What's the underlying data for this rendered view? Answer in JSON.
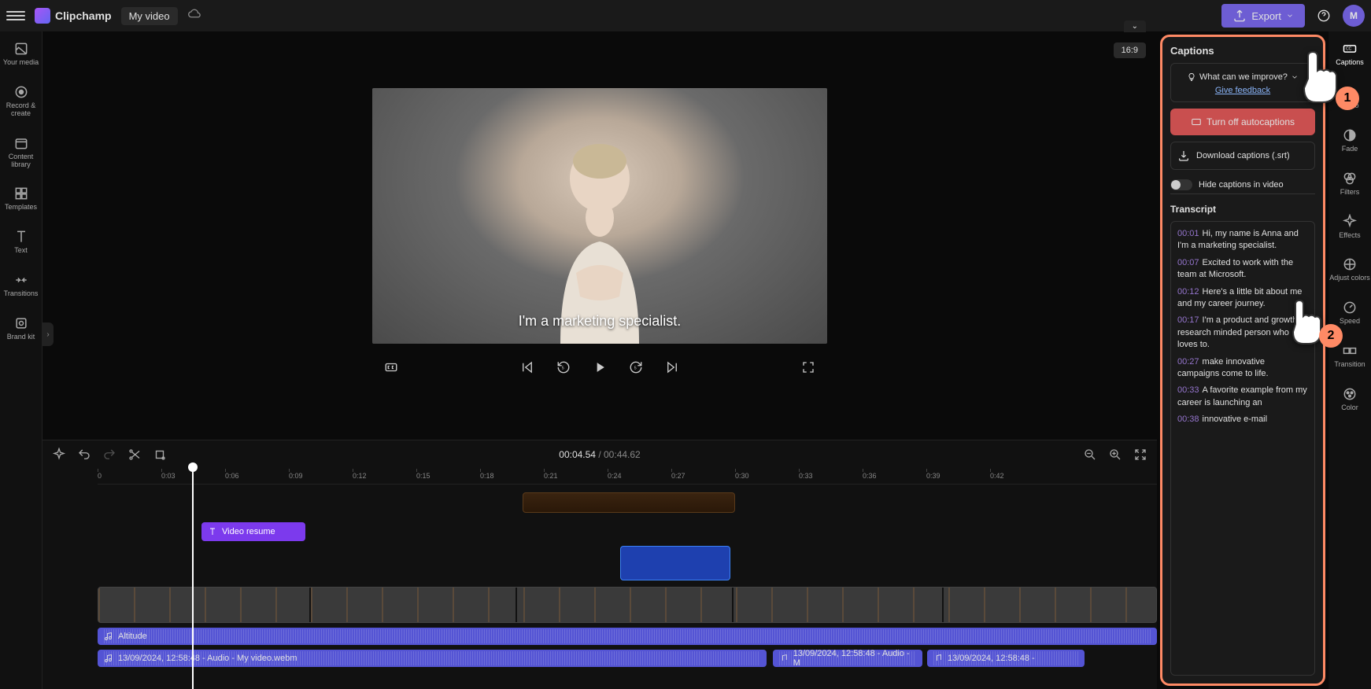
{
  "app": {
    "name": "Clipchamp",
    "project": "My video",
    "aspect": "16:9",
    "export_label": "Export",
    "avatar_initial": "M"
  },
  "left_rail": [
    {
      "label": "Your media",
      "icon": "media"
    },
    {
      "label": "Record & create",
      "icon": "record"
    },
    {
      "label": "Content library",
      "icon": "library"
    },
    {
      "label": "Templates",
      "icon": "templates"
    },
    {
      "label": "Text",
      "icon": "text"
    },
    {
      "label": "Transitions",
      "icon": "transitions"
    },
    {
      "label": "Brand kit",
      "icon": "brand"
    }
  ],
  "far_rail": [
    {
      "label": "Captions",
      "icon": "cc",
      "active": true
    },
    {
      "label": "Audio",
      "icon": "audio"
    },
    {
      "label": "Fade",
      "icon": "fade"
    },
    {
      "label": "Filters",
      "icon": "filters"
    },
    {
      "label": "Effects",
      "icon": "effects"
    },
    {
      "label": "Adjust colors",
      "icon": "adjust"
    },
    {
      "label": "Speed",
      "icon": "speed"
    },
    {
      "label": "Transition",
      "icon": "transition"
    },
    {
      "label": "Color",
      "icon": "color"
    }
  ],
  "preview": {
    "caption": "I'm a marketing specialist."
  },
  "timeline": {
    "current": "00:04.54",
    "duration": "00:44.62",
    "ticks": [
      "0",
      "0:03",
      "0:06",
      "0:09",
      "0:12",
      "0:15",
      "0:18",
      "0:21",
      "0:24",
      "0:27",
      "0:30",
      "0:33",
      "0:36",
      "0:39",
      "0:42"
    ],
    "text_clip": "Video resume",
    "audio1_label": "Altitude",
    "audio2_label": "13/09/2024, 12:58:48 - Audio - My video.webm",
    "audio3_label": "13/09/2024, 12:58:48 - Audio - M",
    "audio4_label": "13/09/2024, 12:58:48 -"
  },
  "captions_panel": {
    "title": "Captions",
    "feedback_q": "What can we improve?",
    "feedback_link": "Give feedback",
    "autocap_btn": "Turn off autocaptions",
    "download_btn": "Download captions (.srt)",
    "hide_toggle": "Hide captions in video",
    "transcript_title": "Transcript",
    "transcript": [
      {
        "t": "00:01",
        "text": "Hi, my name is Anna and I'm a marketing specialist."
      },
      {
        "t": "00:07",
        "text": "Excited to work with the team at Microsoft."
      },
      {
        "t": "00:12",
        "text": "Here's a little bit about me and my career journey."
      },
      {
        "t": "00:17",
        "text": "I'm a product and growth research minded person who loves to."
      },
      {
        "t": "00:27",
        "text": "make innovative campaigns come to life."
      },
      {
        "t": "00:33",
        "text": "A favorite example from my career is launching an"
      },
      {
        "t": "00:38",
        "text": "innovative e-mail"
      }
    ]
  }
}
